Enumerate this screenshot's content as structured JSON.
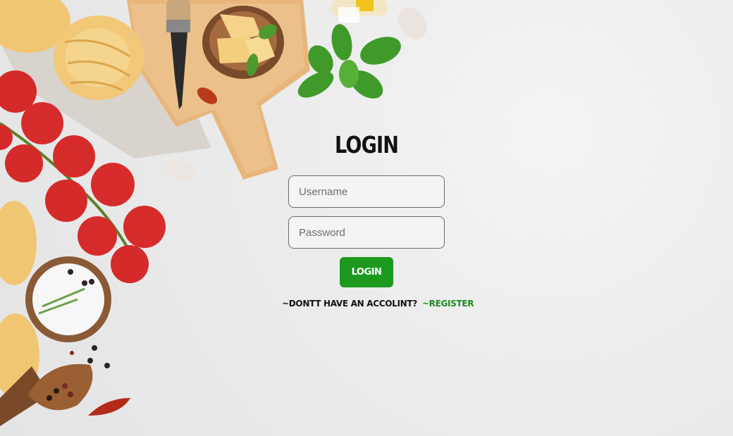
{
  "login": {
    "title": "Login",
    "username_placeholder": "Username",
    "password_placeholder": "Password",
    "button_label": "Login",
    "no_account_text": "~Dontt have an Accolint?",
    "register_link": "~Register"
  },
  "colors": {
    "accent": "#1b9a1e",
    "link": "#1b8a1e",
    "background": "#ececec"
  },
  "decor_icons": [
    "pasta-nest-icon",
    "cutting-board-icon",
    "cheese-bowl-icon",
    "basil-icon",
    "garlic-icon",
    "tomato-vine-icon",
    "salt-bowl-icon",
    "pepper-scoop-icon",
    "chili-icon",
    "oil-bottle-icon"
  ]
}
